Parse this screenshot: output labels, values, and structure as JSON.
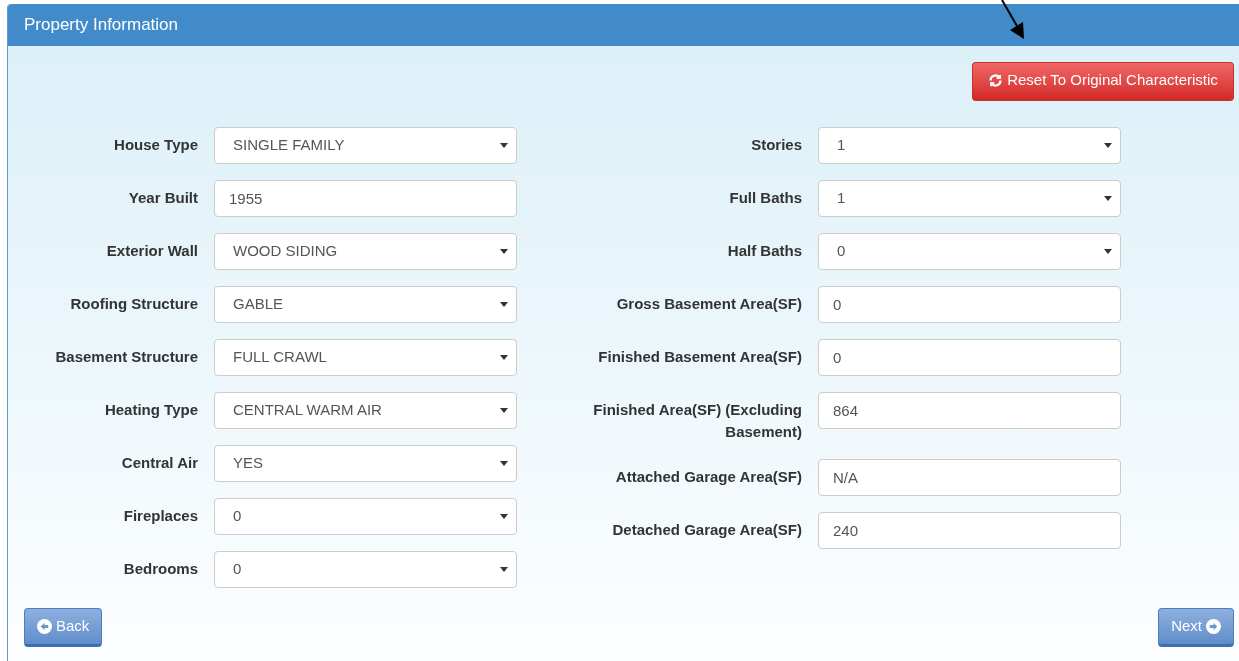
{
  "panel": {
    "title": "Property Information"
  },
  "reset_button": {
    "label": "Reset To Original Characteristic"
  },
  "left_fields": [
    {
      "label": "House Type",
      "kind": "select",
      "value": "SINGLE FAMILY"
    },
    {
      "label": "Year Built",
      "kind": "text",
      "value": "1955"
    },
    {
      "label": "Exterior Wall",
      "kind": "select",
      "value": "WOOD SIDING"
    },
    {
      "label": "Roofing Structure",
      "kind": "select",
      "value": "GABLE"
    },
    {
      "label": "Basement Structure",
      "kind": "select",
      "value": "FULL CRAWL"
    },
    {
      "label": "Heating Type",
      "kind": "select",
      "value": "CENTRAL WARM AIR"
    },
    {
      "label": "Central Air",
      "kind": "select",
      "value": "YES"
    },
    {
      "label": "Fireplaces",
      "kind": "select",
      "value": "0"
    },
    {
      "label": "Bedrooms",
      "kind": "select",
      "value": "0"
    }
  ],
  "right_fields": [
    {
      "label": "Stories",
      "kind": "select",
      "value": "1"
    },
    {
      "label": "Full Baths",
      "kind": "select",
      "value": "1"
    },
    {
      "label": "Half Baths",
      "kind": "select",
      "value": "0"
    },
    {
      "label": "Gross Basement Area(SF)",
      "kind": "text",
      "value": "0"
    },
    {
      "label": "Finished Basement Area(SF)",
      "kind": "text",
      "value": "0"
    },
    {
      "label": "Finished Area(SF) (Excluding Basement)",
      "kind": "text",
      "value": "864"
    },
    {
      "label": "Attached Garage Area(SF)",
      "kind": "text",
      "value": "N/A"
    },
    {
      "label": "Detached Garage Area(SF)",
      "kind": "text",
      "value": "240"
    }
  ],
  "back_button": {
    "label": "Back"
  },
  "next_button": {
    "label": "Next"
  }
}
